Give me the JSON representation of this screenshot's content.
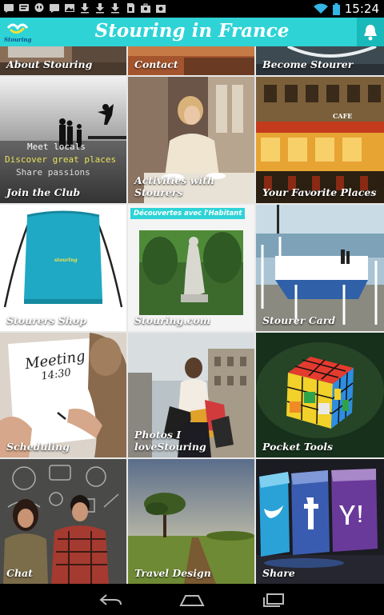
{
  "status_bar": {
    "time": "15:24",
    "icons": [
      "message-icon",
      "message-icon",
      "hangouts-icon",
      "message-icon",
      "photo-icon",
      "download-icon",
      "download-icon",
      "download-icon",
      "sd-card-icon",
      "briefcase-icon",
      "shop-icon"
    ],
    "wifi": "wifi-icon",
    "battery": "battery-icon"
  },
  "app_bar": {
    "title": "Stouring in France",
    "logo_text": "Stouring",
    "notification_icon": "bell-icon",
    "color": "#2ed3d6"
  },
  "tiles": [
    {
      "label": "About Stouring",
      "image": "about-image"
    },
    {
      "label": "Contact",
      "image": "contact-image"
    },
    {
      "label": "Become Stourer",
      "image": "become-image"
    },
    {
      "label": "Join the Club",
      "image": "club-image",
      "overlay_text": [
        "Meet locals",
        "Discover great places",
        "Share passions"
      ]
    },
    {
      "label": "Activities with Stourers",
      "image": "activities-image"
    },
    {
      "label": "Your Favorite Places",
      "image": "places-image",
      "sign_text": "CAFE"
    },
    {
      "label": "Stourers Shop",
      "image": "shop-image",
      "bag_text": "stouring"
    },
    {
      "label": "Stouring.com",
      "image": "website-image",
      "tag": "Découvertes avec l'Habitant"
    },
    {
      "label": "Stourer Card",
      "image": "card-image"
    },
    {
      "label": "Scheduling",
      "image": "scheduling-image",
      "note_text": [
        "Meeting",
        "14:30"
      ]
    },
    {
      "label": "Photos I loveStouring",
      "image": "photos-image"
    },
    {
      "label": "Pocket Tools",
      "image": "tools-image"
    },
    {
      "label": "Chat",
      "image": "chat-image"
    },
    {
      "label": "Travel Design",
      "image": "travel-image"
    },
    {
      "label": "Share",
      "image": "share-image",
      "social": [
        "Twitter",
        "Facebook",
        "Yahoo"
      ]
    }
  ],
  "nav_bar": {
    "back": "back-icon",
    "home": "home-icon",
    "recents": "recents-icon"
  }
}
